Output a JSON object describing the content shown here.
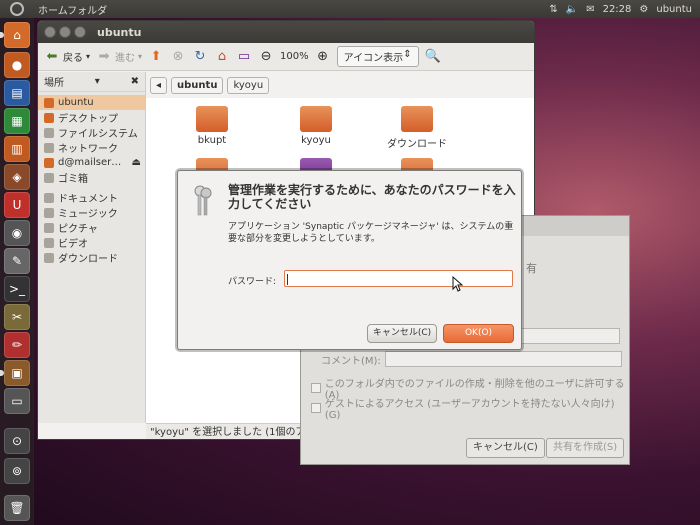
{
  "top_panel": {
    "title": "ホームフォルダ",
    "time": "22:28",
    "user": "ubuntu"
  },
  "nautilus": {
    "window_title": "ubuntu",
    "toolbar": {
      "back": "戻る",
      "forward": "進む",
      "zoom": "100%",
      "view": "アイコン表示"
    },
    "sidebar": {
      "header": "場所",
      "items": [
        {
          "label": "ubuntu"
        },
        {
          "label": "デスクトップ"
        },
        {
          "label": "ファイルシステム"
        },
        {
          "label": "ネットワーク"
        },
        {
          "label": "d@mailser…"
        },
        {
          "label": "ゴミ箱"
        },
        {
          "label": "ドキュメント"
        },
        {
          "label": "ミュージック"
        },
        {
          "label": "ピクチャ"
        },
        {
          "label": "ビデオ"
        },
        {
          "label": "ダウンロード"
        }
      ]
    },
    "path": [
      "ubuntu",
      "kyoyu"
    ],
    "files": [
      {
        "name": "bkupt"
      },
      {
        "name": "kyoyu"
      },
      {
        "name": "ダウンロード"
      }
    ],
    "status": "\"kyoyu\" を選択しました (1個のアイ"
  },
  "share_dialog": {
    "partial_title": "有",
    "comment_label": "コメント(M):",
    "allow_others": "このフォルダ内でのファイルの作成・削除を他のユーザに許可する(A)",
    "guest": "ゲストによるアクセス (ユーザーアカウントを持たない人々向け) (G)",
    "cancel": "キャンセル(C)",
    "create": "共有を作成(S)"
  },
  "auth_dialog": {
    "heading": "管理作業を実行するために、あなたのパスワードを入力してください",
    "description": "アプリケーション 'Synaptic パッケージマネージャ' は、システムの重要な部分を変更しようとしています。",
    "password_label": "パスワード:",
    "password_value": "",
    "cancel": "キャンセル(C)",
    "ok": "OK(O)"
  }
}
